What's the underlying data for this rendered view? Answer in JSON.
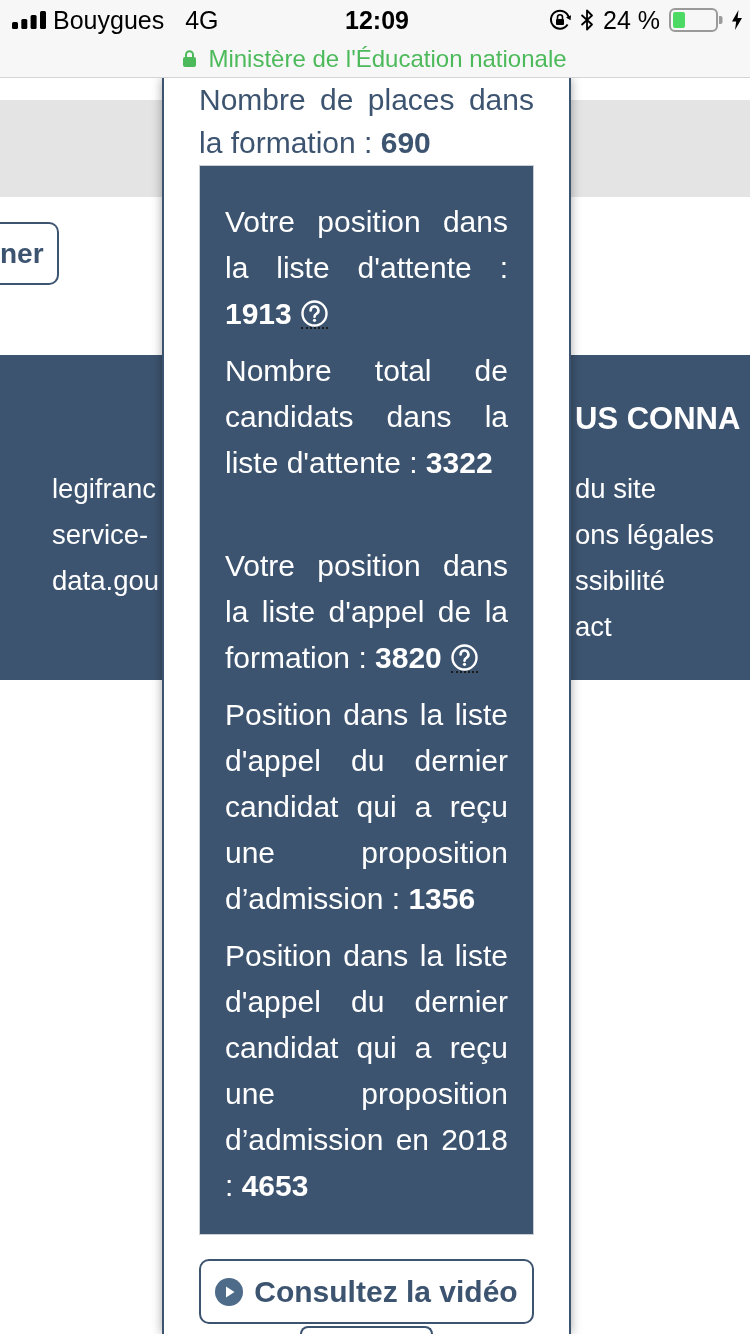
{
  "status_bar": {
    "carrier": "Bouygues",
    "network": "4G",
    "time": "12:09",
    "battery": "24 %"
  },
  "address_bar": {
    "site": "Ministère de l'Éducation nationale"
  },
  "page": {
    "partial_button": "ner",
    "footer": {
      "left_links": [
        "legifranc",
        "service-",
        "data.gou"
      ],
      "heading": "US CONNA",
      "right_links": [
        "du site",
        "ons légales",
        "ssibilité",
        "act"
      ]
    }
  },
  "modal": {
    "places": "Nombre de places dans la formation : **690**",
    "groups": [
      {
        "paragraphs": [
          {
            "text": "Votre position dans la liste d'attente :",
            "last_line": "**1913**",
            "help": true
          },
          {
            "text": "Nombre total de candidats dans la liste d'attente : **3322**",
            "help": false
          }
        ]
      },
      {
        "paragraphs": [
          {
            "text": "Votre position dans la liste d'appel de la",
            "last_line": "formation : **3820**",
            "help": true
          },
          {
            "text": "Position dans la liste d'appel du dernier candidat qui a reçu une proposition d’admission : **1356**",
            "help": false
          },
          {
            "text": "Position dans la liste d'appel du dernier candidat qui a reçu une proposition d’admission en 2018 : **4653**",
            "help": false
          }
        ]
      }
    ],
    "video_button": "Consultez la vidéo"
  }
}
